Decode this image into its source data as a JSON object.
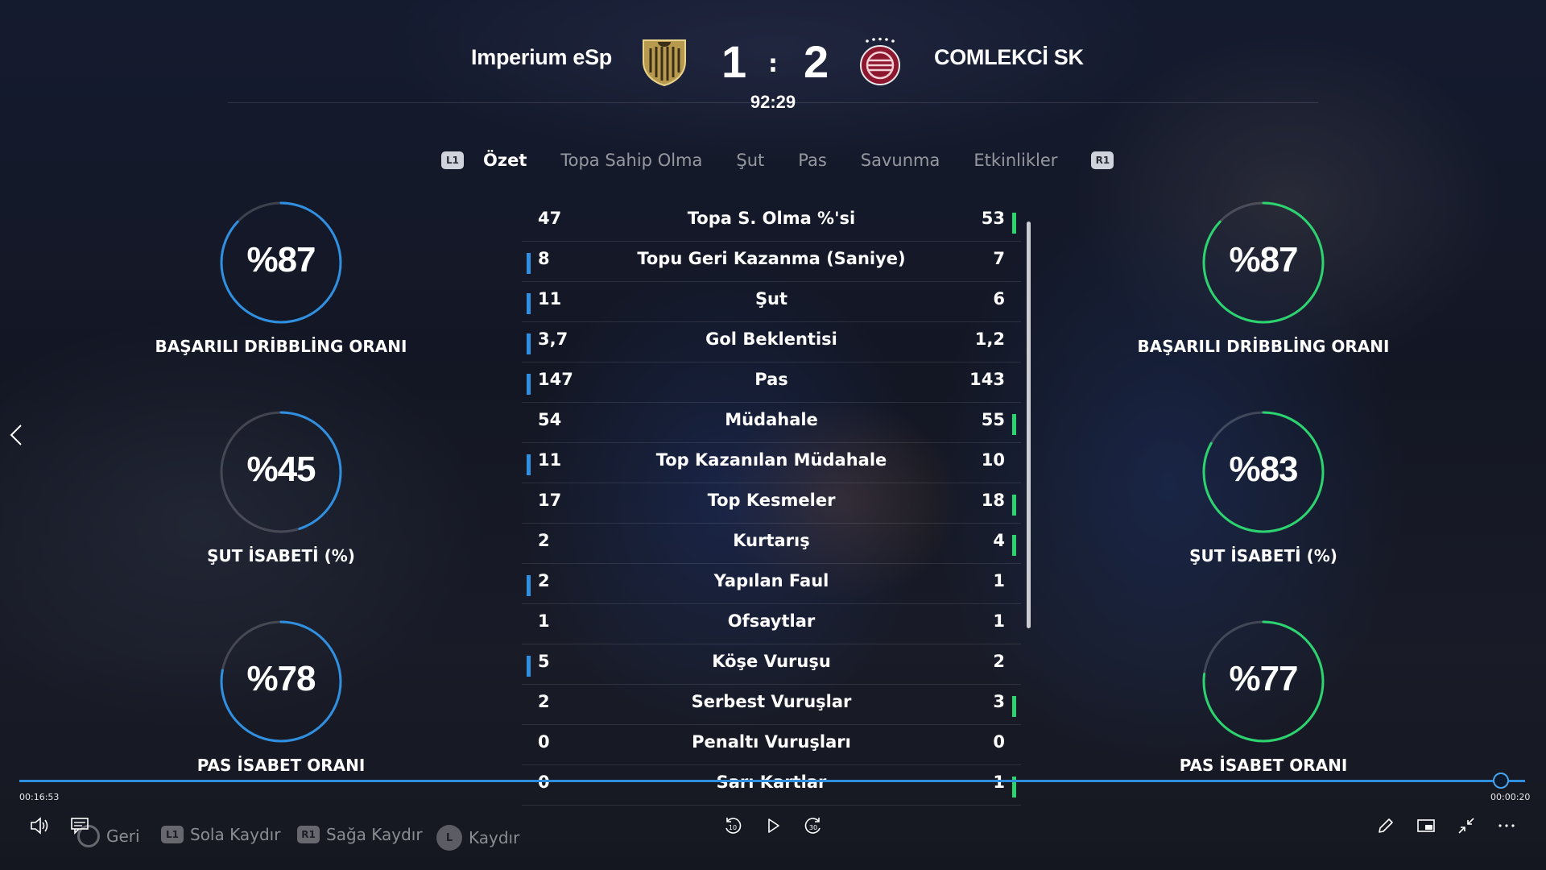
{
  "match": {
    "home_team": "Imperium eSp",
    "away_team": "COMLEKCİ SK",
    "home_score": "1",
    "away_score": "2",
    "separator": ":",
    "clock": "92:29"
  },
  "tabs": {
    "left_button": "L1",
    "right_button": "R1",
    "items": [
      "Özet",
      "Topa Sahip Olma",
      "Şut",
      "Pas",
      "Savunma",
      "Etkinlikler"
    ],
    "active": "Özet"
  },
  "rings": {
    "home": [
      {
        "value": "%87",
        "label": "BAŞARILI DRİBBLİNG ORANI",
        "percent": 87
      },
      {
        "value": "%45",
        "label": "ŞUT İSABETİ (%)",
        "percent": 45
      },
      {
        "value": "%78",
        "label": "PAS İSABET ORANI",
        "percent": 78
      }
    ],
    "away": [
      {
        "value": "%87",
        "label": "BAŞARILI DRİBBLİNG ORANI",
        "percent": 87
      },
      {
        "value": "%83",
        "label": "ŞUT İSABETİ (%)",
        "percent": 83
      },
      {
        "value": "%77",
        "label": "PAS İSABET ORANI",
        "percent": 77
      }
    ],
    "home_color": "#2f8fe0",
    "away_color": "#2bd46f"
  },
  "stats": [
    {
      "home": "47",
      "label": "Topa S. Olma %'si",
      "away": "53",
      "leader": "away"
    },
    {
      "home": "8",
      "label": "Topu Geri Kazanma (Saniye)",
      "away": "7",
      "leader": "home"
    },
    {
      "home": "11",
      "label": "Şut",
      "away": "6",
      "leader": "home"
    },
    {
      "home": "3,7",
      "label": "Gol Beklentisi",
      "away": "1,2",
      "leader": "home"
    },
    {
      "home": "147",
      "label": "Pas",
      "away": "143",
      "leader": "home"
    },
    {
      "home": "54",
      "label": "Müdahale",
      "away": "55",
      "leader": "away"
    },
    {
      "home": "11",
      "label": "Top Kazanılan Müdahale",
      "away": "10",
      "leader": "home"
    },
    {
      "home": "17",
      "label": "Top Kesmeler",
      "away": "18",
      "leader": "away"
    },
    {
      "home": "2",
      "label": "Kurtarış",
      "away": "4",
      "leader": "away"
    },
    {
      "home": "2",
      "label": "Yapılan Faul",
      "away": "1",
      "leader": "home"
    },
    {
      "home": "1",
      "label": "Ofsaytlar",
      "away": "1",
      "leader": "none"
    },
    {
      "home": "5",
      "label": "Köşe Vuruşu",
      "away": "2",
      "leader": "home"
    },
    {
      "home": "2",
      "label": "Serbest Vuruşlar",
      "away": "3",
      "leader": "away"
    },
    {
      "home": "0",
      "label": "Penaltı Vuruşları",
      "away": "0",
      "leader": "none"
    },
    {
      "home": "0",
      "label": "Sarı Kartlar",
      "away": "1",
      "leader": "away"
    }
  ],
  "player": {
    "elapsed": "00:16:53",
    "remaining": "00:00:20",
    "progress": 0.984
  },
  "hints": [
    {
      "key": "",
      "label": "Geri"
    },
    {
      "key": "L1",
      "label": "Sola Kaydır"
    },
    {
      "key": "R1",
      "label": "Sağa Kaydır"
    },
    {
      "key": "L",
      "label": "Kaydır"
    }
  ]
}
